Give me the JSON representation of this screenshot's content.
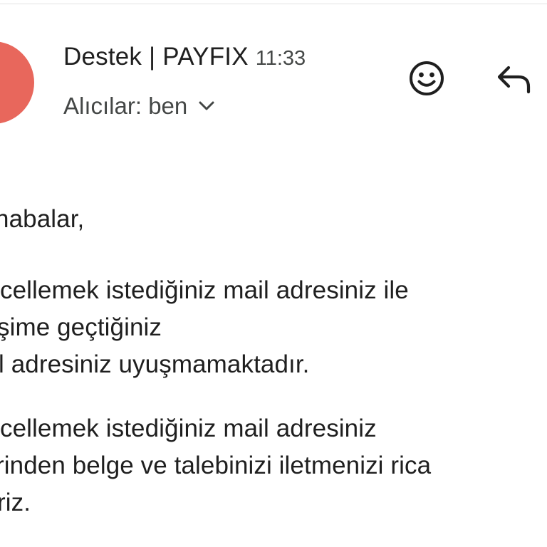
{
  "email": {
    "sender": "Destek | PAYFIX",
    "time": "11:33",
    "recipients_label": "Alıcılar: ben",
    "avatar_color": "#e8675c"
  },
  "actions": {
    "emoji_icon": "add-reaction-icon",
    "reply_icon": "reply-icon"
  },
  "body": {
    "greeting": "habalar,",
    "paragraph1": [
      "cellemek istediğiniz mail adresiniz ile",
      "şime geçtiğiniz",
      "l adresiniz uyuşmamaktadır."
    ],
    "paragraph2": [
      "cellemek istediğiniz mail adresiniz",
      "rinden belge ve talebinizi iletmenizi rica",
      "riz."
    ]
  }
}
